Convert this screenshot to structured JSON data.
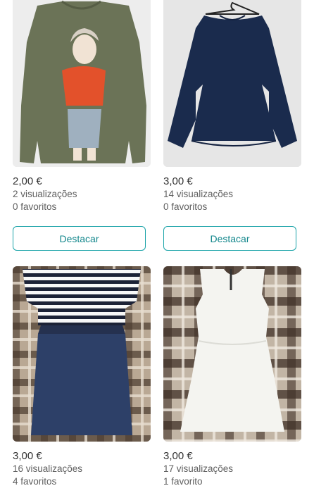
{
  "items": [
    {
      "image": "olive-long-sleeve-tshirt-with-woman-print",
      "price": "2,00 €",
      "views": "2 visualizações",
      "favorites": "0 favoritos",
      "button": "Destacar"
    },
    {
      "image": "navy-blue-peplum-blouse-with-bell-sleeves",
      "price": "3,00 €",
      "views": "14 visualizações",
      "favorites": "0 favoritos",
      "button": "Destacar"
    },
    {
      "image": "striped-top-denim-skirt-dress",
      "price": "3,00 €",
      "views": "16 visualizações",
      "favorites": "4 favoritos"
    },
    {
      "image": "white-sleeveless-dress",
      "price": "3,00 €",
      "views": "17 visualizações",
      "favorites": "1 favorito"
    }
  ],
  "colors": {
    "accent": "#1aa3a8",
    "price_text": "#333333",
    "meta_text": "#5f5f5f"
  }
}
